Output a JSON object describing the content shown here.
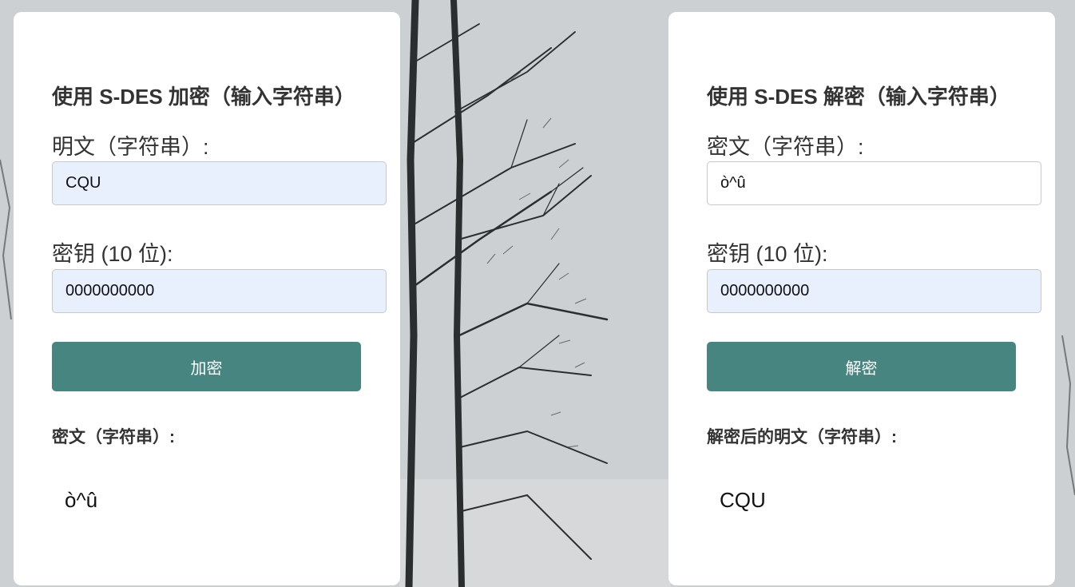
{
  "encrypt_panel": {
    "title": "使用 S-DES 加密（输入字符串）",
    "plaintext_label": "明文（字符串）:",
    "plaintext_value": "CQU",
    "key_label": "密钥 (10 位):",
    "key_value": "0000000000",
    "button_label": "加密",
    "result_label": "密文（字符串）:",
    "result_value": "ò^û"
  },
  "decrypt_panel": {
    "title": "使用 S-DES 解密（输入字符串）",
    "ciphertext_label": "密文（字符串）:",
    "ciphertext_value": "ò^û",
    "key_label": "密钥 (10 位):",
    "key_value": "0000000000",
    "button_label": "解密",
    "result_label": "解密后的明文（字符串）:",
    "result_value": "CQU"
  },
  "colors": {
    "button": "#478680",
    "card": "#ffffff",
    "autofill_input": "#e8f0fe"
  }
}
